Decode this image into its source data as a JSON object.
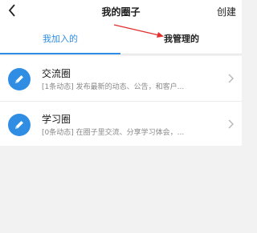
{
  "header": {
    "title": "我的圈子",
    "create_label": "创建",
    "back_icon": "chevron-left-icon"
  },
  "tabs": [
    {
      "label": "我加入的",
      "active": true
    },
    {
      "label": "我管理的",
      "active": false
    }
  ],
  "circles": [
    {
      "name": "交流圈",
      "description": "[1条动态] 发布最新的动态、公告，和客户...",
      "icon": "edit-icon"
    },
    {
      "name": "学习圈",
      "description": "[0条动态] 在圈子里交流、分享学习体会，...",
      "icon": "edit-icon"
    }
  ],
  "colors": {
    "accent": "#2f8de4",
    "annotation_arrow": "#e0302f",
    "background": "#f2f2f2"
  }
}
